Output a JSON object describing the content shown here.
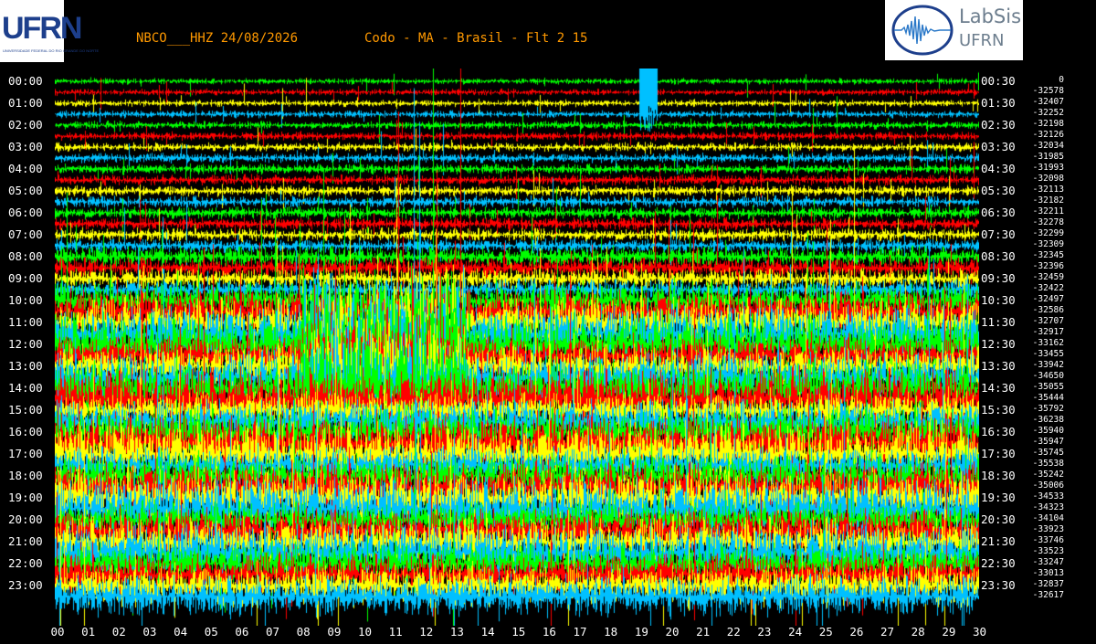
{
  "header": {
    "station_title": "NBCO___HHZ 24/08/2026",
    "location_title": "Codo - MA - Brasil - Flt 2 15"
  },
  "logos": {
    "left_text": "UFRN",
    "left_small_text": "UNIVERSIDADE FEDERAL DO RIO GRANDE DO NORTE",
    "right_text_top": "LabSis",
    "right_text_bottom": "UFRN"
  },
  "colors": {
    "background": "#000000",
    "title": "#ff9900",
    "traces": [
      "#00ff00",
      "#ff0000",
      "#ffff00",
      "#00c0ff"
    ]
  },
  "left_hour_labels": [
    "00:00",
    "01:00",
    "02:00",
    "03:00",
    "04:00",
    "05:00",
    "06:00",
    "07:00",
    "08:00",
    "09:00",
    "10:00",
    "11:00",
    "12:00",
    "13:00",
    "14:00",
    "15:00",
    "16:00",
    "17:00",
    "18:00",
    "19:00",
    "20:00",
    "21:00",
    "22:00",
    "23:00"
  ],
  "right_hour_labels": [
    "00:30",
    "01:30",
    "02:30",
    "03:30",
    "04:30",
    "05:30",
    "06:30",
    "07:30",
    "08:30",
    "09:30",
    "10:30",
    "11:30",
    "12:30",
    "13:30",
    "14:30",
    "15:30",
    "16:30",
    "17:30",
    "18:30",
    "19:30",
    "20:30",
    "21:30",
    "22:30",
    "23:30"
  ],
  "offsets": [
    "0",
    "-32578",
    "-32407",
    "-32252",
    "-32198",
    "-32126",
    "-32034",
    "-31985",
    "-31993",
    "-32098",
    "-32113",
    "-32182",
    "-32211",
    "-32278",
    "-32299",
    "-32309",
    "-32345",
    "-32396",
    "-32459",
    "-32422",
    "-32497",
    "-32586",
    "-32707",
    "-32917",
    "-33162",
    "-33455",
    "-33942",
    "-34650",
    "-35055",
    "-35444",
    "-35792",
    "-36238",
    "-35940",
    "-35947",
    "-35745",
    "-35538",
    "-35242",
    "-35006",
    "-34533",
    "-34323",
    "-34104",
    "-33923",
    "-33746",
    "-33523",
    "-33247",
    "-33013",
    "-32837",
    "-32617"
  ],
  "x_ticks": [
    "00",
    "01",
    "02",
    "03",
    "04",
    "05",
    "06",
    "07",
    "08",
    "09",
    "10",
    "11",
    "12",
    "13",
    "14",
    "15",
    "16",
    "17",
    "18",
    "19",
    "20",
    "21",
    "22",
    "23",
    "24",
    "25",
    "26",
    "27",
    "28",
    "29",
    "30"
  ]
}
